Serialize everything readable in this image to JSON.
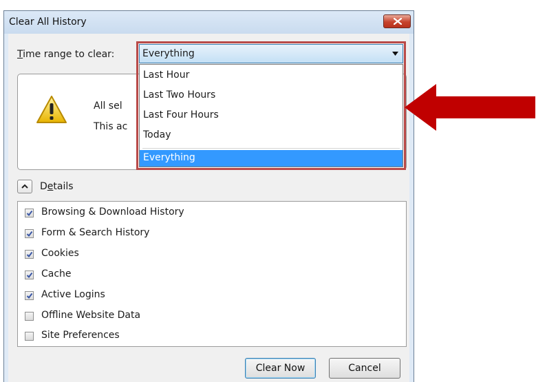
{
  "window": {
    "title": "Clear All History"
  },
  "time_range": {
    "label_prefix": "T",
    "label_rest": "ime range to clear:",
    "selected": "Everything",
    "options": [
      "Last Hour",
      "Last Two Hours",
      "Last Four Hours",
      "Today",
      "Everything"
    ]
  },
  "warning": {
    "line1": "All sel",
    "line2": "This ac"
  },
  "details": {
    "label_prefix": "D",
    "label_underlined": "e",
    "label_rest": "tails"
  },
  "items": [
    {
      "label": "Browsing & Download History",
      "checked": true
    },
    {
      "label": "Form & Search History",
      "checked": true
    },
    {
      "label": "Cookies",
      "checked": true
    },
    {
      "label": "Cache",
      "checked": true
    },
    {
      "label": "Active Logins",
      "checked": true
    },
    {
      "label": "Offline Website Data",
      "checked": false
    },
    {
      "label": "Site Preferences",
      "checked": false
    }
  ],
  "buttons": {
    "clear_now": "Clear Now",
    "cancel": "Cancel"
  },
  "colors": {
    "highlight_frame": "#b94a48",
    "arrow": "#c00000",
    "selection": "#3399ff"
  }
}
